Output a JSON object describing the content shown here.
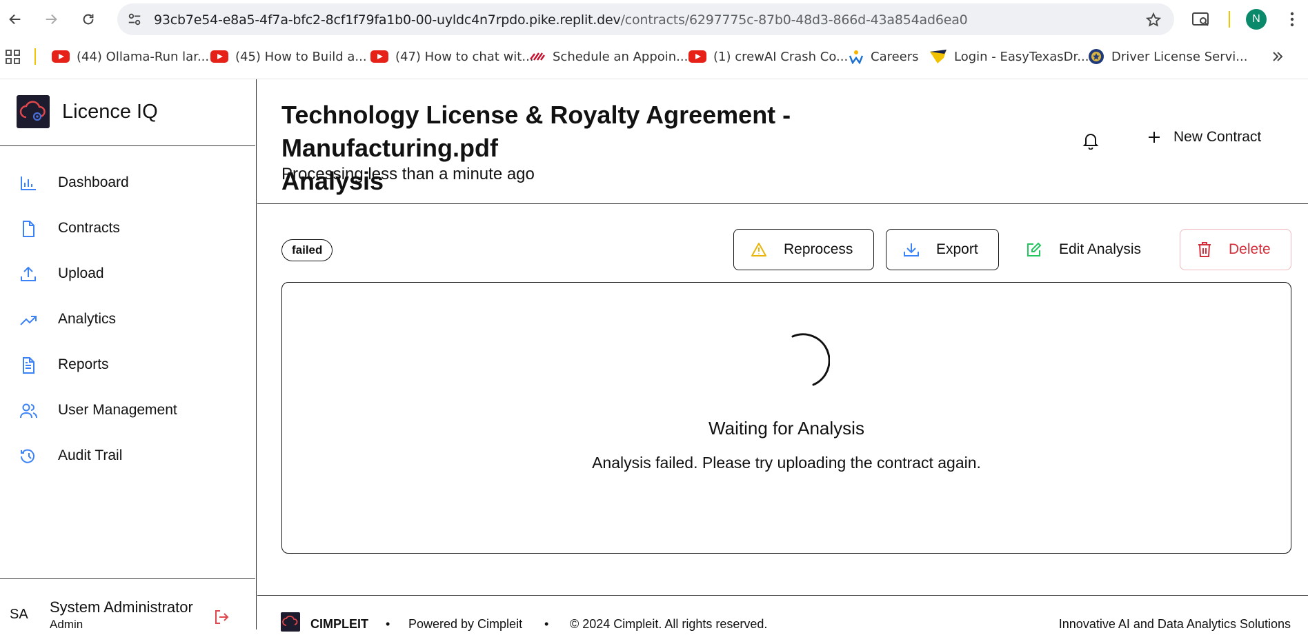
{
  "browser": {
    "url_host": "93cb7e54-e8a5-4f7a-bfc2-8cf1f79fa1b0-00-uyldc4n7rpdo.pike.replit.dev",
    "url_path": "/contracts/6297775c-87b0-48d3-866d-43a854ad6ea0",
    "profile_initial": "N",
    "bookmarks": [
      {
        "label": "(44) Ollama-Run lar...",
        "icon": "youtube-icon"
      },
      {
        "label": "(45) How to Build a...",
        "icon": "youtube-icon"
      },
      {
        "label": "(47) How to chat wit...",
        "icon": "youtube-icon"
      },
      {
        "label": "Schedule an Appoin...",
        "icon": "flag-icon"
      },
      {
        "label": "(1) crewAI Crash Co...",
        "icon": "youtube-icon"
      },
      {
        "label": "Careers",
        "icon": "careers-icon"
      },
      {
        "label": "Login - EasyTexasDr...",
        "icon": "shield-icon"
      },
      {
        "label": "Driver License Servi...",
        "icon": "seal-icon"
      }
    ]
  },
  "sidebar": {
    "brand": "Licence IQ",
    "items": [
      {
        "label": "Dashboard",
        "icon": "bar-chart-icon"
      },
      {
        "label": "Contracts",
        "icon": "file-icon"
      },
      {
        "label": "Upload",
        "icon": "upload-icon"
      },
      {
        "label": "Analytics",
        "icon": "trending-up-icon"
      },
      {
        "label": "Reports",
        "icon": "file-text-icon"
      },
      {
        "label": "User Management",
        "icon": "users-icon"
      },
      {
        "label": "Audit Trail",
        "icon": "history-icon"
      }
    ],
    "user": {
      "initials": "SA",
      "name": "System Administrator",
      "role": "Admin"
    }
  },
  "header": {
    "title_line1": "Technology License & Royalty Agreement - Manufacturing.pdf",
    "title_line2": "Analysis",
    "subtitle": "Processing less than a minute ago",
    "new_contract_label": "New Contract"
  },
  "status_badge": "failed",
  "actions": {
    "reprocess": "Reprocess",
    "export": "Export",
    "edit": "Edit Analysis",
    "delete": "Delete"
  },
  "panel": {
    "title": "Waiting for Analysis",
    "message": "Analysis failed. Please try uploading the contract again."
  },
  "footer": {
    "brand": "CIMPLEIT",
    "powered": "Powered by Cimpleit",
    "copyright": "© 2024 Cimpleit. All rights reserved.",
    "tagline": "Innovative AI and Data Analytics Solutions"
  },
  "colors": {
    "accent_blue": "#3b82f6",
    "warning": "#eab308",
    "success": "#22c55e",
    "danger": "#d32f3a"
  }
}
